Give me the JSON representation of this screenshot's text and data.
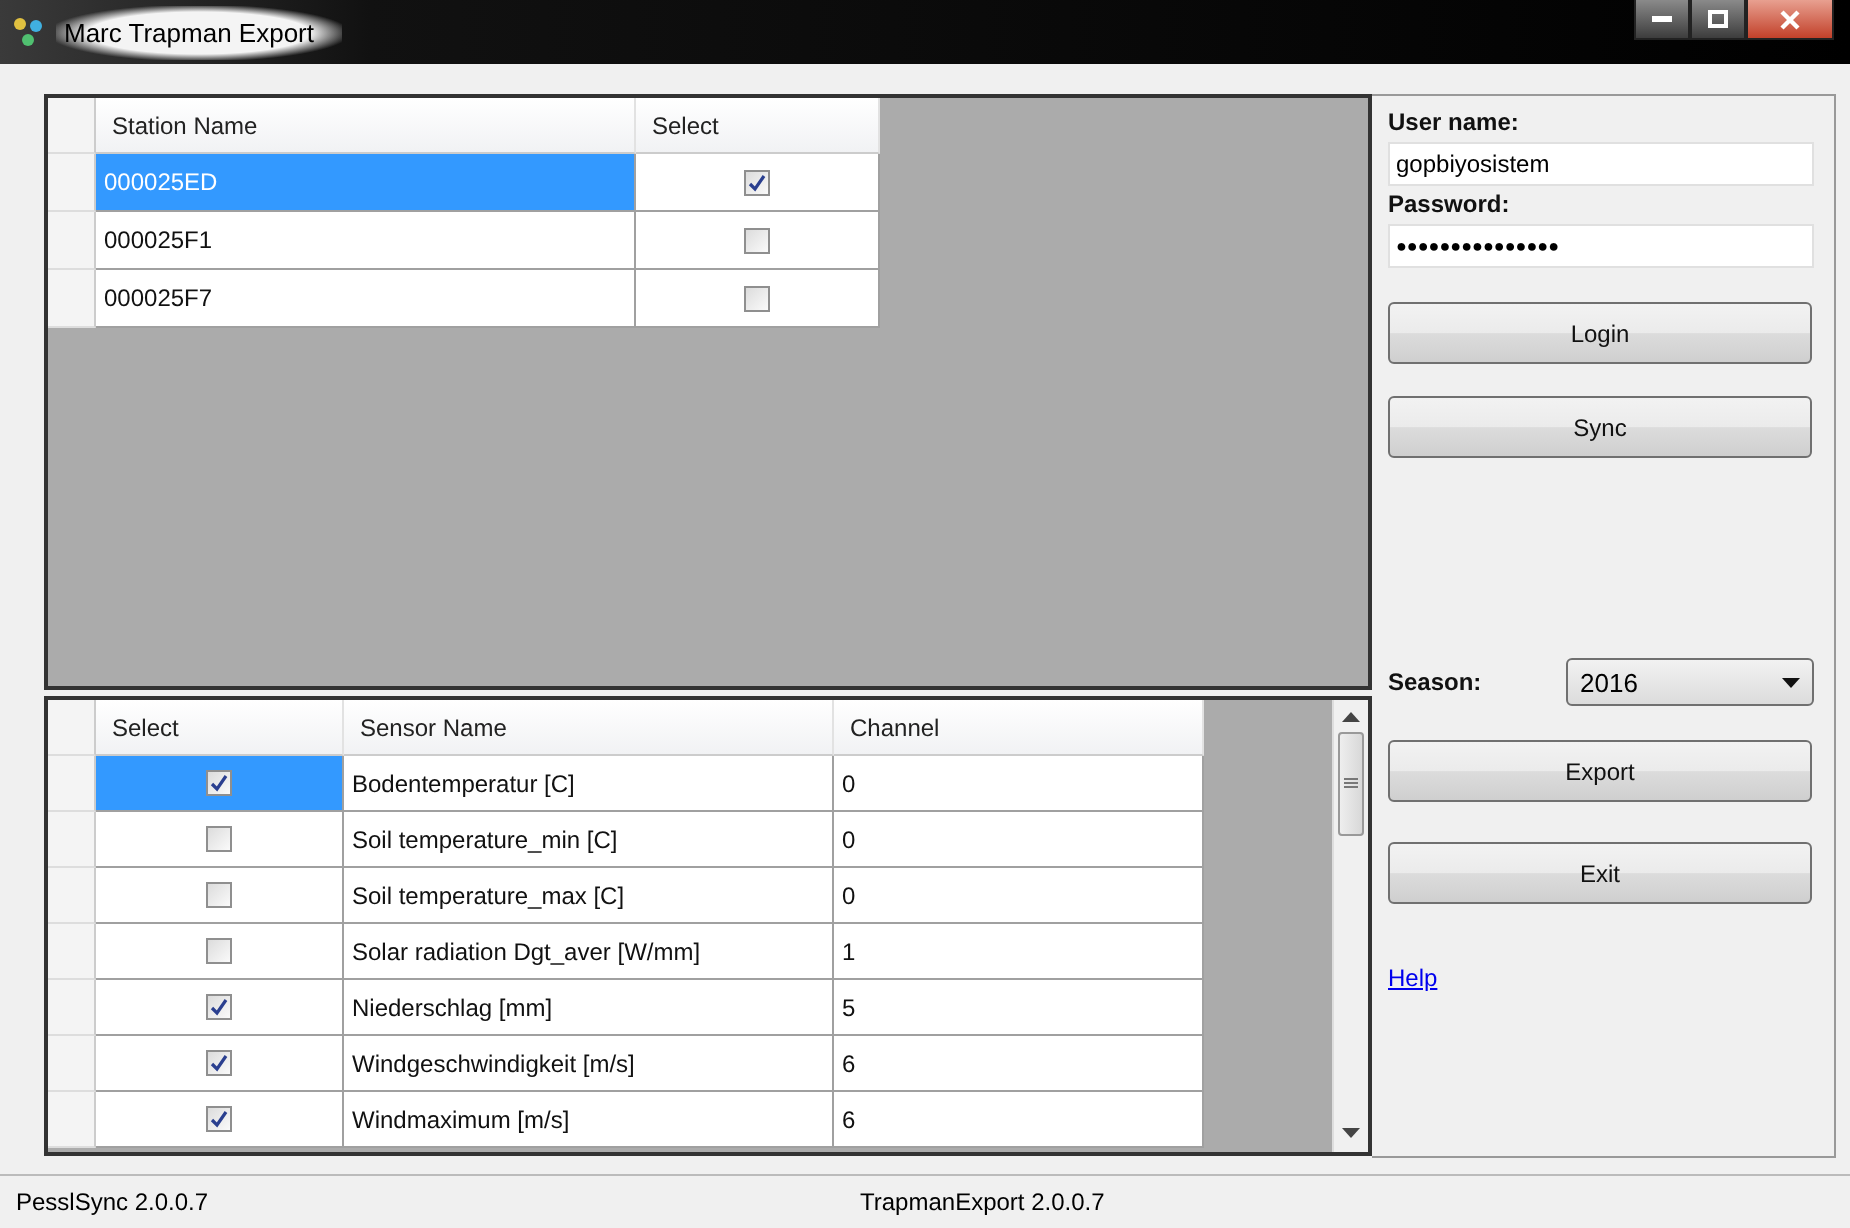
{
  "window": {
    "title": "Marc Trapman Export"
  },
  "stations": {
    "columns": [
      "Station Name",
      "Select"
    ],
    "rows": [
      {
        "name": "000025ED",
        "checked": true,
        "selected": true
      },
      {
        "name": "000025F1",
        "checked": false,
        "selected": false
      },
      {
        "name": "000025F7",
        "checked": false,
        "selected": false
      }
    ]
  },
  "sensors": {
    "columns": [
      "Select",
      "Sensor Name",
      "Channel"
    ],
    "rows": [
      {
        "name": "Bodentemperatur [C]",
        "channel": "0",
        "checked": true,
        "selected": true
      },
      {
        "name": "Soil temperature_min [C]",
        "channel": "0",
        "checked": false,
        "selected": false
      },
      {
        "name": "Soil temperature_max [C]",
        "channel": "0",
        "checked": false,
        "selected": false
      },
      {
        "name": "Solar radiation Dgt_aver [W/mm]",
        "channel": "1",
        "checked": false,
        "selected": false
      },
      {
        "name": "Niederschlag [mm]",
        "channel": "5",
        "checked": true,
        "selected": false
      },
      {
        "name": "Windgeschwindigkeit [m/s]",
        "channel": "6",
        "checked": true,
        "selected": false
      },
      {
        "name": "Windmaximum [m/s]",
        "channel": "6",
        "checked": true,
        "selected": false
      }
    ]
  },
  "login": {
    "username_label": "User name:",
    "username": "gopbiyosistem",
    "password_label": "Password:",
    "password": "●●●●●●●●●●●●●●●",
    "buttons": [
      "Login",
      "Sync"
    ]
  },
  "season": {
    "label": "Season:",
    "value": "2016"
  },
  "actions": [
    "Export",
    "Exit"
  ],
  "help_link": "Help",
  "status_bar": [
    "PesslSync 2.0.0.7",
    "TrapmanExport 2.0.0.7"
  ]
}
